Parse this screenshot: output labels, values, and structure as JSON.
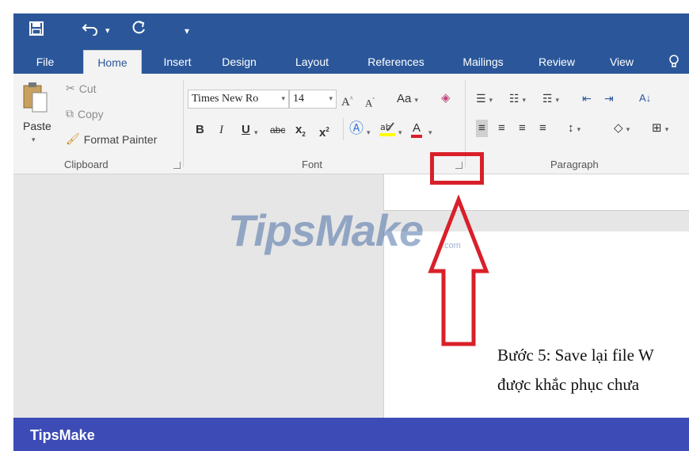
{
  "qat": {
    "save_icon": "save-icon",
    "undo_icon": "undo-icon",
    "redo_icon": "redo-icon",
    "customize_icon": "customize-qat-icon"
  },
  "tabs": {
    "file": "File",
    "home": "Home",
    "insert": "Insert",
    "design": "Design",
    "layout": "Layout",
    "references": "References",
    "mailings": "Mailings",
    "review": "Review",
    "view": "View",
    "tell_me_icon": "lightbulb-icon"
  },
  "clipboard": {
    "paste": "Paste",
    "cut": "Cut",
    "copy": "Copy",
    "format_painter": "Format Painter",
    "group_label": "Clipboard"
  },
  "font": {
    "font_name": "Times New Ro",
    "font_size": "14",
    "change_case": "Aa",
    "bold": "B",
    "italic": "I",
    "underline": "U",
    "strikethrough": "abc",
    "subscript": "x",
    "superscript": "x",
    "font_color": "A",
    "group_label": "Font"
  },
  "paragraph": {
    "group_label": "Paragraph"
  },
  "document": {
    "line1": "Bước 5: Save lại file W",
    "line2": "được khắc phục chưa"
  },
  "watermark": {
    "brand": "TipsMake",
    "sub": ".com"
  },
  "footer": {
    "brand": "TipsMake"
  },
  "colors": {
    "word_blue": "#2b579a",
    "footer_blue": "#3d4bb7",
    "highlight_red": "#d9202a"
  }
}
